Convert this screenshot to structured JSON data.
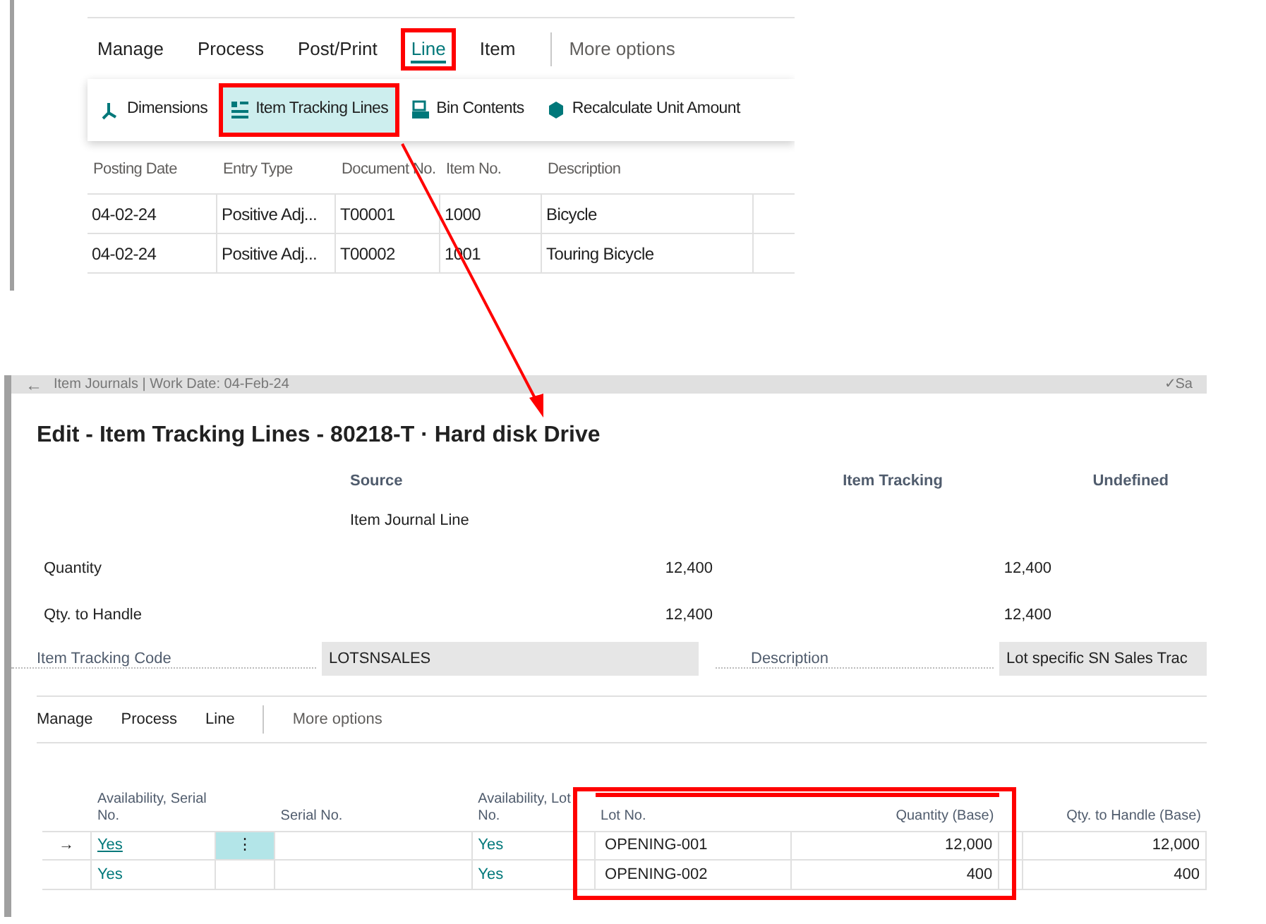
{
  "journal": {
    "tabs": [
      {
        "label": "Manage",
        "highlighted": false
      },
      {
        "label": "Process",
        "highlighted": false
      },
      {
        "label": "Post/Print",
        "highlighted": false
      },
      {
        "label": "Line",
        "highlighted": true,
        "selected": true
      },
      {
        "label": "Item",
        "highlighted": false
      }
    ],
    "more_options": "More options",
    "actions": [
      {
        "label": "Dimensions",
        "highlighted": false
      },
      {
        "label": "Item Tracking Lines",
        "highlighted": true
      },
      {
        "label": "Bin Contents",
        "highlighted": false
      },
      {
        "label": "Recalculate Unit Amount",
        "highlighted": false
      }
    ],
    "columns": [
      "Posting Date",
      "Entry Type",
      "Document No.",
      "Item No.",
      "Description"
    ],
    "rows": [
      [
        "04-02-24",
        "Positive Adj...",
        "T00001",
        "1000",
        "Bicycle"
      ],
      [
        "04-02-24",
        "Positive Adj...",
        "T00002",
        "1001",
        "Touring Bicycle"
      ]
    ]
  },
  "dialog": {
    "back_glyph": "←",
    "breadcrumb": "Item Journals | Work Date: 04-Feb-24",
    "save_glyph": "✓",
    "save_status": "Sa",
    "title": "Edit - Item Tracking Lines - 80218-T · Hard disk Drive",
    "summary_headers": [
      "Source",
      "Item Tracking",
      "Undefined"
    ],
    "source_name": "Item Journal Line",
    "summary_rows": [
      {
        "label": "Quantity",
        "item_tracking": "12,400",
        "undefined": "12,400"
      },
      {
        "label": "Qty. to Handle",
        "item_tracking": "12,400",
        "undefined": "12,400"
      }
    ],
    "fields": [
      {
        "label": "Item Tracking Code",
        "value": "LOTSNSALES"
      },
      {
        "label": "Description",
        "value": "Lot specific SN Sales Trac"
      }
    ],
    "menu": [
      "Manage",
      "Process",
      "Line"
    ],
    "more_options": "More options",
    "pointer_glyph": "→",
    "row_menu_glyph": "⋮",
    "columns": [
      {
        "label": "Availability, Serial No.",
        "highlighted": false
      },
      {
        "label": "Serial No.",
        "highlighted": false
      },
      {
        "label": "Availability, Lot No.",
        "highlighted": false
      },
      {
        "label": "Lot No.",
        "highlighted": true
      },
      {
        "label": "Quantity (Base)",
        "highlighted": true
      },
      {
        "label": "Qty. to Handle (Base)",
        "highlighted": false
      }
    ],
    "lines": [
      {
        "selected": true,
        "availability_serial": "Yes",
        "availability_lot": "Yes",
        "lot_no": "OPENING-001",
        "quantity": "12,000",
        "qty_to_handle": "12,000"
      },
      {
        "selected": false,
        "availability_serial": "Yes",
        "availability_lot": "Yes",
        "lot_no": "OPENING-002",
        "quantity": "400",
        "qty_to_handle": "400"
      }
    ]
  }
}
